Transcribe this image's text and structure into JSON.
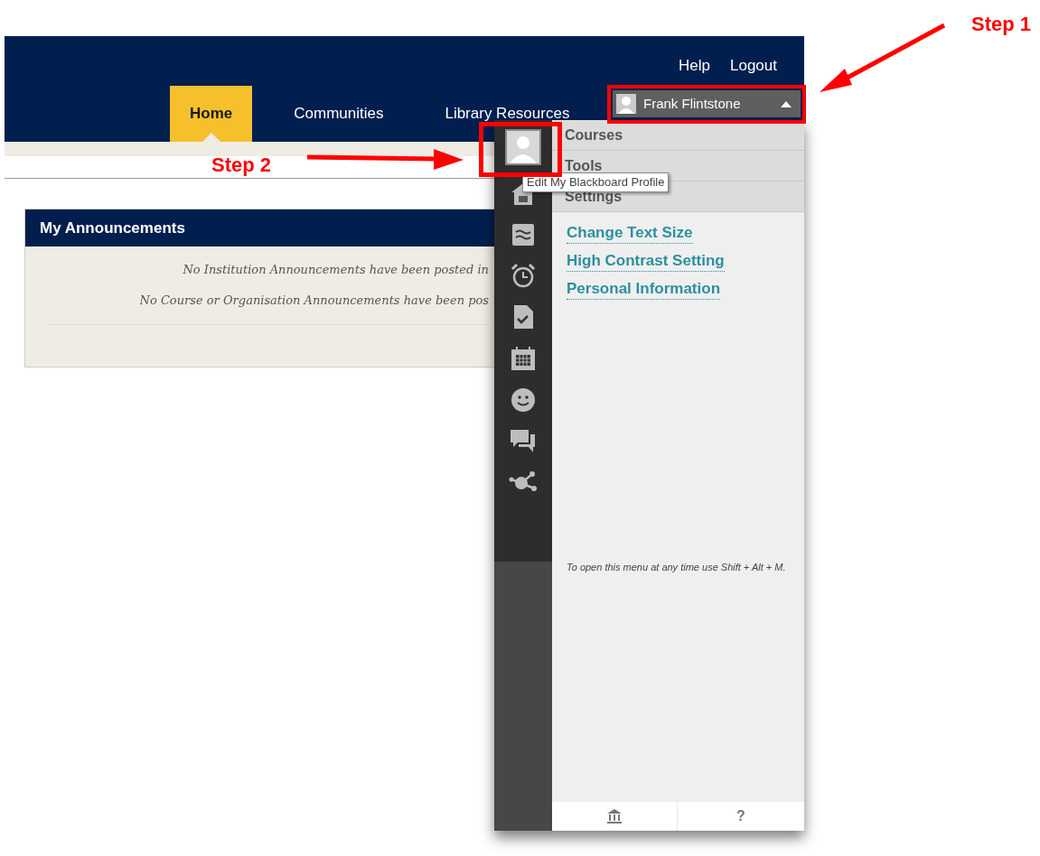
{
  "header": {
    "links": [
      "Help",
      "Logout"
    ],
    "tabs": [
      {
        "label": "Home",
        "selected": true
      },
      {
        "label": "Communities",
        "selected": false
      },
      {
        "label": "Library Resources",
        "selected": false
      }
    ],
    "user_menu": {
      "name": "Frank Flintstone",
      "expanded": true
    }
  },
  "announcements": {
    "title": "My Announcements",
    "messages": [
      "No Institution Announcements have been posted in",
      "No Course or Organisation Announcements have been pos"
    ]
  },
  "global_menu": {
    "sections": [
      {
        "label": "Courses"
      },
      {
        "label": "Tools"
      },
      {
        "label": "Settings"
      }
    ],
    "settings_links": [
      "Change Text Size",
      "High Contrast Setting",
      "Personal Information"
    ],
    "tooltip": "Edit My Blackboard Profile",
    "hint": "To open this menu at any time use Shift + Alt + M.",
    "footer_help": "?"
  },
  "annotations": [
    {
      "label": "Step 1"
    },
    {
      "label": "Step 2"
    }
  ]
}
